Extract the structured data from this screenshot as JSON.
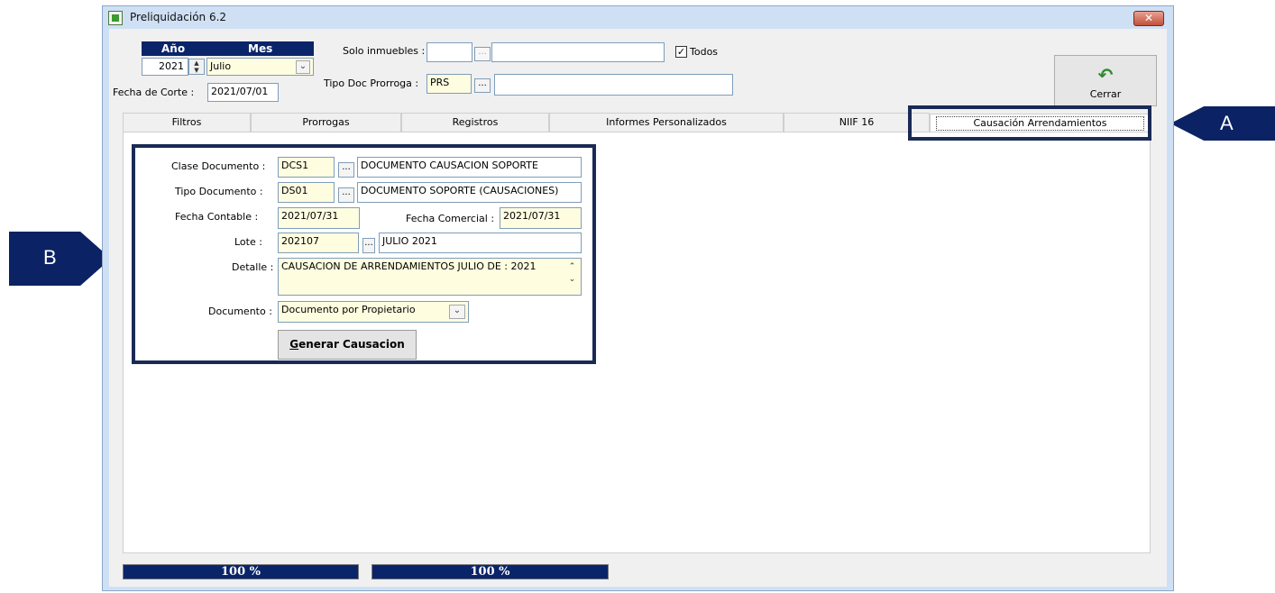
{
  "window": {
    "title": "Preliquidación 6.2",
    "close_glyph": "✕"
  },
  "header": {
    "year_header": "Año",
    "month_header": "Mes",
    "year_value": "2021",
    "month_value": "Julio",
    "fecha_corte_label": "Fecha de Corte :",
    "fecha_corte_value": "2021/07/01",
    "solo_inmuebles_label": "Solo inmuebles :",
    "solo_inmuebles_code": "",
    "solo_inmuebles_desc": "",
    "todos_label": "Todos",
    "todos_checked": true,
    "tipo_doc_prorroga_label": "Tipo Doc Prorroga :",
    "tipo_doc_prorroga_code": "PRS",
    "tipo_doc_prorroga_desc": "",
    "cerrar_label": "Cerrar",
    "cerrar_icon": "undo-arrow-icon"
  },
  "tabs": [
    {
      "label": "Filtros"
    },
    {
      "label": "Prorrogas"
    },
    {
      "label": "Registros"
    },
    {
      "label": "Informes Personalizados"
    },
    {
      "label": "NIIF 16"
    },
    {
      "label": "Causación Arrendamientos",
      "active": true
    }
  ],
  "form": {
    "clase_documento_label": "Clase Documento :",
    "clase_documento_code": "DCS1",
    "clase_documento_desc": "DOCUMENTO CAUSACION SOPORTE",
    "tipo_documento_label": "Tipo Documento :",
    "tipo_documento_code": "DS01",
    "tipo_documento_desc": "DOCUMENTO SOPORTE (CAUSACIONES)",
    "fecha_contable_label": "Fecha Contable :",
    "fecha_contable_value": "2021/07/31",
    "fecha_comercial_label": "Fecha Comercial :",
    "fecha_comercial_value": "2021/07/31",
    "lote_label": "Lote :",
    "lote_code": "202107",
    "lote_desc": "JULIO 2021",
    "detalle_label": "Detalle :",
    "detalle_value": "CAUSACION DE ARRENDAMIENTOS  JULIO  DE : 2021",
    "documento_label": "Documento :",
    "documento_value": "Documento por Propietario",
    "generar_mnemonic": "G",
    "generar_rest": "enerar Causacion",
    "lookup_label": "..."
  },
  "progress": [
    {
      "label": "100 %",
      "value": 100
    },
    {
      "label": "100 %",
      "value": 100
    }
  ],
  "callouts": {
    "a": "A",
    "b": "B"
  },
  "colors": {
    "progress_fill": "#0a246a",
    "callout_bg": "#0b2264",
    "highlight_border": "#1a2a55",
    "field_bg": "#fffde0"
  }
}
